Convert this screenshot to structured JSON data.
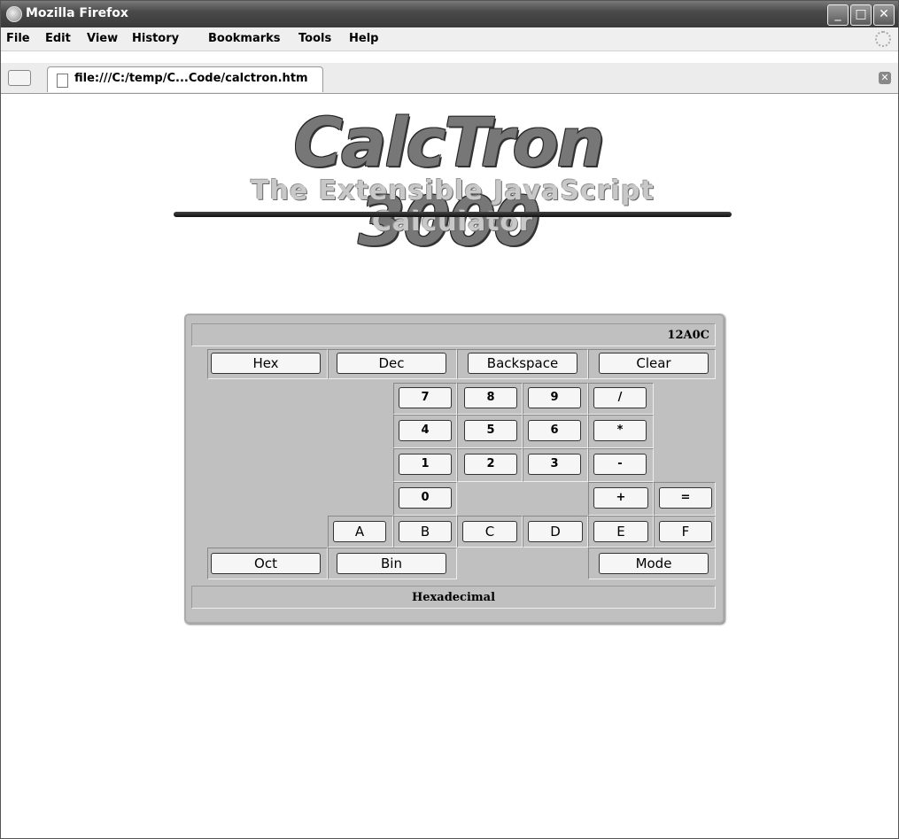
{
  "window": {
    "title": "Mozilla Firefox"
  },
  "menubar": {
    "items": [
      "File",
      "Edit",
      "View",
      "History",
      "Bookmarks",
      "Tools",
      "Help"
    ]
  },
  "tab": {
    "label": "file:///C:/temp/C...Code/calctron.htm"
  },
  "logo": {
    "line1": "CalcTron 3000",
    "line2": "The Extensible JavaScript Calculator"
  },
  "calculator": {
    "display": "12A0C",
    "status": "Hexadecimal",
    "buttons": {
      "hex": "Hex",
      "dec": "Dec",
      "backspace": "Backspace",
      "clear": "Clear",
      "k7": "7",
      "k8": "8",
      "k9": "9",
      "div": "/",
      "k4": "4",
      "k5": "5",
      "k6": "6",
      "mul": "*",
      "k1": "1",
      "k2": "2",
      "k3": "3",
      "sub": "-",
      "k0": "0",
      "add": "+",
      "eq": "=",
      "kA": "A",
      "kB": "B",
      "kC": "C",
      "kD": "D",
      "kE": "E",
      "kF": "F",
      "oct": "Oct",
      "bin": "Bin",
      "mode": "Mode"
    }
  }
}
